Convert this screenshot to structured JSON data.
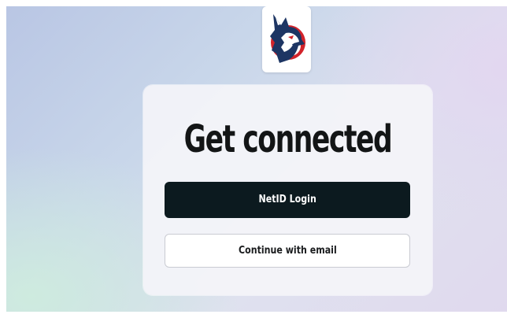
{
  "brand": {
    "logo_icon": "husky-mascot-icon",
    "colors": {
      "navy": "#1d3563",
      "red": "#d2232a",
      "primary_button": "#0c1a1f"
    }
  },
  "login": {
    "title": "Get connected",
    "netid_button_label": "NetID Login",
    "email_button_label": "Continue with email"
  }
}
